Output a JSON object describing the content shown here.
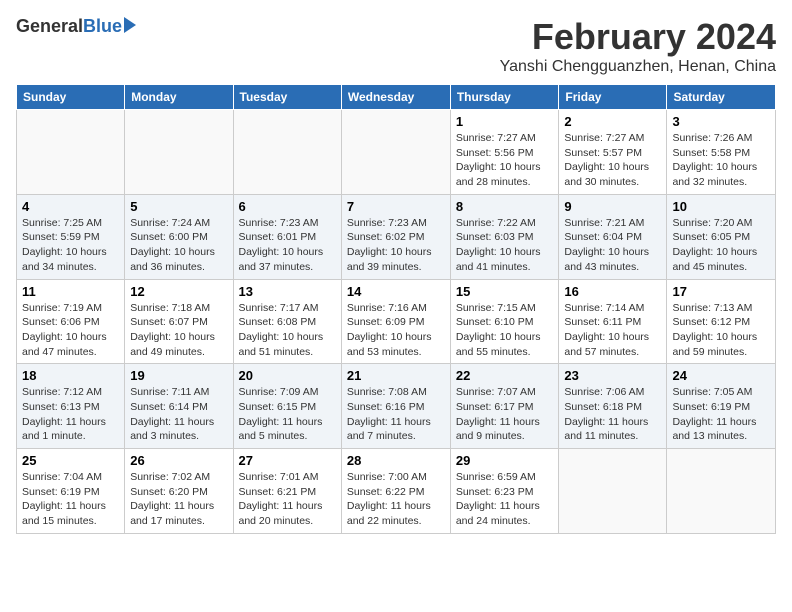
{
  "header": {
    "logo_general": "General",
    "logo_blue": "Blue",
    "month_title": "February 2024",
    "location": "Yanshi Chengguanzhen, Henan, China"
  },
  "days_of_week": [
    "Sunday",
    "Monday",
    "Tuesday",
    "Wednesday",
    "Thursday",
    "Friday",
    "Saturday"
  ],
  "weeks": [
    [
      {
        "day": "",
        "info": ""
      },
      {
        "day": "",
        "info": ""
      },
      {
        "day": "",
        "info": ""
      },
      {
        "day": "",
        "info": ""
      },
      {
        "day": "1",
        "info": "Sunrise: 7:27 AM\nSunset: 5:56 PM\nDaylight: 10 hours and 28 minutes."
      },
      {
        "day": "2",
        "info": "Sunrise: 7:27 AM\nSunset: 5:57 PM\nDaylight: 10 hours and 30 minutes."
      },
      {
        "day": "3",
        "info": "Sunrise: 7:26 AM\nSunset: 5:58 PM\nDaylight: 10 hours and 32 minutes."
      }
    ],
    [
      {
        "day": "4",
        "info": "Sunrise: 7:25 AM\nSunset: 5:59 PM\nDaylight: 10 hours and 34 minutes."
      },
      {
        "day": "5",
        "info": "Sunrise: 7:24 AM\nSunset: 6:00 PM\nDaylight: 10 hours and 36 minutes."
      },
      {
        "day": "6",
        "info": "Sunrise: 7:23 AM\nSunset: 6:01 PM\nDaylight: 10 hours and 37 minutes."
      },
      {
        "day": "7",
        "info": "Sunrise: 7:23 AM\nSunset: 6:02 PM\nDaylight: 10 hours and 39 minutes."
      },
      {
        "day": "8",
        "info": "Sunrise: 7:22 AM\nSunset: 6:03 PM\nDaylight: 10 hours and 41 minutes."
      },
      {
        "day": "9",
        "info": "Sunrise: 7:21 AM\nSunset: 6:04 PM\nDaylight: 10 hours and 43 minutes."
      },
      {
        "day": "10",
        "info": "Sunrise: 7:20 AM\nSunset: 6:05 PM\nDaylight: 10 hours and 45 minutes."
      }
    ],
    [
      {
        "day": "11",
        "info": "Sunrise: 7:19 AM\nSunset: 6:06 PM\nDaylight: 10 hours and 47 minutes."
      },
      {
        "day": "12",
        "info": "Sunrise: 7:18 AM\nSunset: 6:07 PM\nDaylight: 10 hours and 49 minutes."
      },
      {
        "day": "13",
        "info": "Sunrise: 7:17 AM\nSunset: 6:08 PM\nDaylight: 10 hours and 51 minutes."
      },
      {
        "day": "14",
        "info": "Sunrise: 7:16 AM\nSunset: 6:09 PM\nDaylight: 10 hours and 53 minutes."
      },
      {
        "day": "15",
        "info": "Sunrise: 7:15 AM\nSunset: 6:10 PM\nDaylight: 10 hours and 55 minutes."
      },
      {
        "day": "16",
        "info": "Sunrise: 7:14 AM\nSunset: 6:11 PM\nDaylight: 10 hours and 57 minutes."
      },
      {
        "day": "17",
        "info": "Sunrise: 7:13 AM\nSunset: 6:12 PM\nDaylight: 10 hours and 59 minutes."
      }
    ],
    [
      {
        "day": "18",
        "info": "Sunrise: 7:12 AM\nSunset: 6:13 PM\nDaylight: 11 hours and 1 minute."
      },
      {
        "day": "19",
        "info": "Sunrise: 7:11 AM\nSunset: 6:14 PM\nDaylight: 11 hours and 3 minutes."
      },
      {
        "day": "20",
        "info": "Sunrise: 7:09 AM\nSunset: 6:15 PM\nDaylight: 11 hours and 5 minutes."
      },
      {
        "day": "21",
        "info": "Sunrise: 7:08 AM\nSunset: 6:16 PM\nDaylight: 11 hours and 7 minutes."
      },
      {
        "day": "22",
        "info": "Sunrise: 7:07 AM\nSunset: 6:17 PM\nDaylight: 11 hours and 9 minutes."
      },
      {
        "day": "23",
        "info": "Sunrise: 7:06 AM\nSunset: 6:18 PM\nDaylight: 11 hours and 11 minutes."
      },
      {
        "day": "24",
        "info": "Sunrise: 7:05 AM\nSunset: 6:19 PM\nDaylight: 11 hours and 13 minutes."
      }
    ],
    [
      {
        "day": "25",
        "info": "Sunrise: 7:04 AM\nSunset: 6:19 PM\nDaylight: 11 hours and 15 minutes."
      },
      {
        "day": "26",
        "info": "Sunrise: 7:02 AM\nSunset: 6:20 PM\nDaylight: 11 hours and 17 minutes."
      },
      {
        "day": "27",
        "info": "Sunrise: 7:01 AM\nSunset: 6:21 PM\nDaylight: 11 hours and 20 minutes."
      },
      {
        "day": "28",
        "info": "Sunrise: 7:00 AM\nSunset: 6:22 PM\nDaylight: 11 hours and 22 minutes."
      },
      {
        "day": "29",
        "info": "Sunrise: 6:59 AM\nSunset: 6:23 PM\nDaylight: 11 hours and 24 minutes."
      },
      {
        "day": "",
        "info": ""
      },
      {
        "day": "",
        "info": ""
      }
    ]
  ]
}
